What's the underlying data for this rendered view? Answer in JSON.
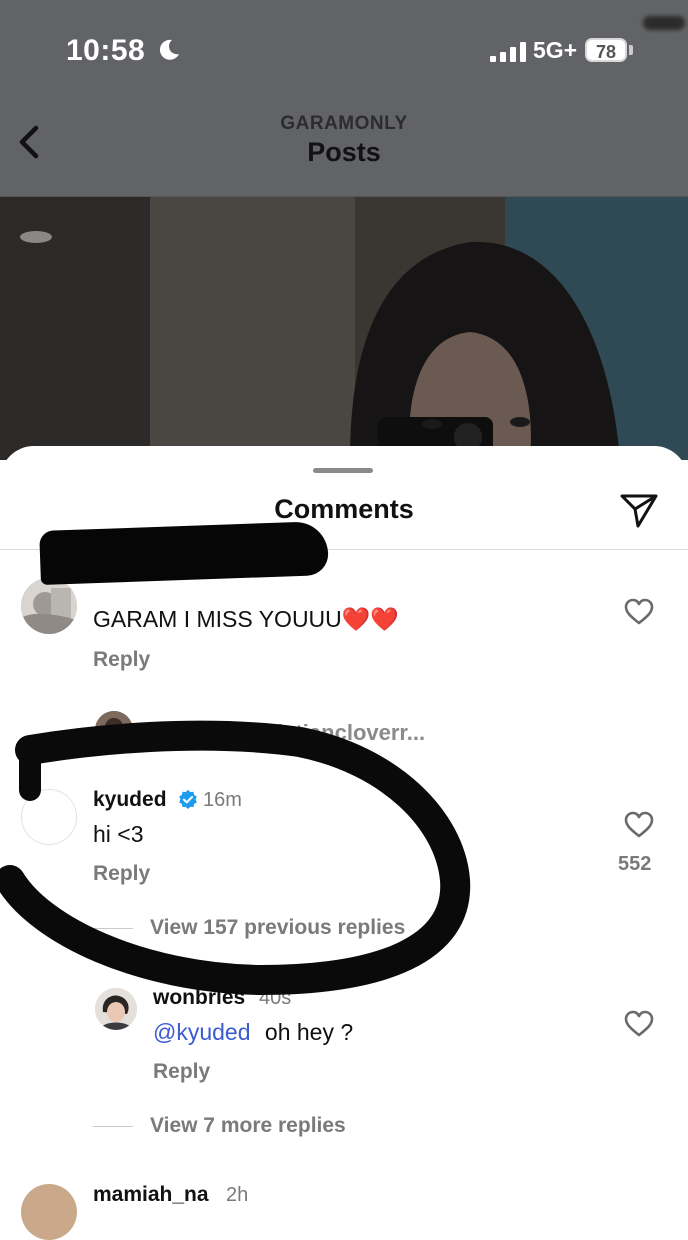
{
  "status_bar": {
    "time": "10:58",
    "network": "5G+",
    "battery": "78",
    "icons": [
      "moon-icon",
      "signal-icon",
      "battery-icon"
    ]
  },
  "header": {
    "username": "GARAMONLY",
    "title": "Posts",
    "back_icon": "chevron-left-icon"
  },
  "comments_sheet": {
    "title": "Comments",
    "share_icon": "paper-plane-icon",
    "comments": [
      {
        "username": "",
        "text": "GARAM I MISS YOUUU❤️❤️",
        "reply_label": "Reply",
        "reply_prompt": "Reply to christiancloverr..."
      },
      {
        "username": "kyuded",
        "verified": true,
        "time": "16m",
        "text": "hi <3",
        "reply_label": "Reply",
        "likes": "552",
        "view_previous": "View 157 previous replies"
      },
      {
        "username": "wonbries",
        "time": "40s",
        "mention": "@kyuded",
        "text": "oh hey ?",
        "reply_label": "Reply",
        "view_more": "View 7 more replies"
      },
      {
        "username": "mamiah_na",
        "time": "2h"
      }
    ]
  },
  "colors": {
    "overlay": "#626366",
    "mention": "#3b5bd1",
    "verified": "#1d9bf0",
    "heart": "#e0202e",
    "muted": "#7a7a7a"
  }
}
